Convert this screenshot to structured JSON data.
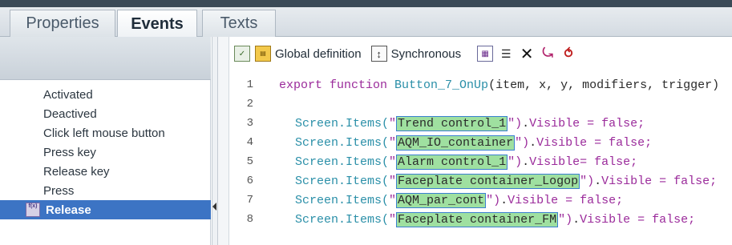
{
  "tabs": [
    {
      "label": "Properties"
    },
    {
      "label": "Events"
    },
    {
      "label": "Texts"
    }
  ],
  "events": [
    {
      "label": "Activated"
    },
    {
      "label": "Deactived"
    },
    {
      "label": "Click left mouse button"
    },
    {
      "label": "Press key"
    },
    {
      "label": "Release key"
    },
    {
      "label": "Press"
    },
    {
      "label": "Release",
      "icon_text": "f(x)"
    }
  ],
  "toolbar": {
    "icons": [
      "save-check-icon",
      "global-definition-icon",
      "synchronous-icon",
      "grid-icon",
      "list-icon",
      "delete-x-icon",
      "add-script-icon",
      "remove-script-icon"
    ],
    "global_definition": "Global definition",
    "synchronous": "Synchronous"
  },
  "code": {
    "line1": {
      "num": "1",
      "kw": "export function ",
      "fn": "Button_7_OnUp",
      "rest": "(item, x, y, modifiers, trigger)"
    },
    "line2": {
      "num": "2"
    },
    "items": [
      {
        "num": "3",
        "pre": "Screen.Items(",
        "q1": "\"",
        "name": "Trend control_1",
        "q2": "\")",
        "dot": ".",
        "prop": "Visible",
        "post": " = false;"
      },
      {
        "num": "4",
        "pre": "Screen.Items(",
        "q1": "\"",
        "name": "AQM_IO_container",
        "q2": "\")",
        "dot": ".",
        "prop": "Visible",
        "post": " = false;"
      },
      {
        "num": "5",
        "pre": "Screen.Items(",
        "q1": "\"",
        "name": "Alarm control_1",
        "q2": "\")",
        "dot": ".",
        "prop": "Visible",
        "post": "= false;"
      },
      {
        "num": "6",
        "pre": "Screen.Items(",
        "q1": "\"",
        "name": "Faceplate container_Logop",
        "q2": "\")",
        "dot": ".",
        "prop": "Visible",
        "post": " = false;"
      },
      {
        "num": "7",
        "pre": "Screen.Items(",
        "q1": "\"",
        "name": "AQM_par_cont",
        "q2": "\")",
        "dot": ".",
        "prop": "Visible",
        "post": " = false;"
      },
      {
        "num": "8",
        "pre": "Screen.Items(",
        "q1": "\"",
        "name": "Faceplate container_FM",
        "q2": "\")",
        "dot": ".",
        "prop": "Visible",
        "post": " = false;"
      }
    ]
  }
}
